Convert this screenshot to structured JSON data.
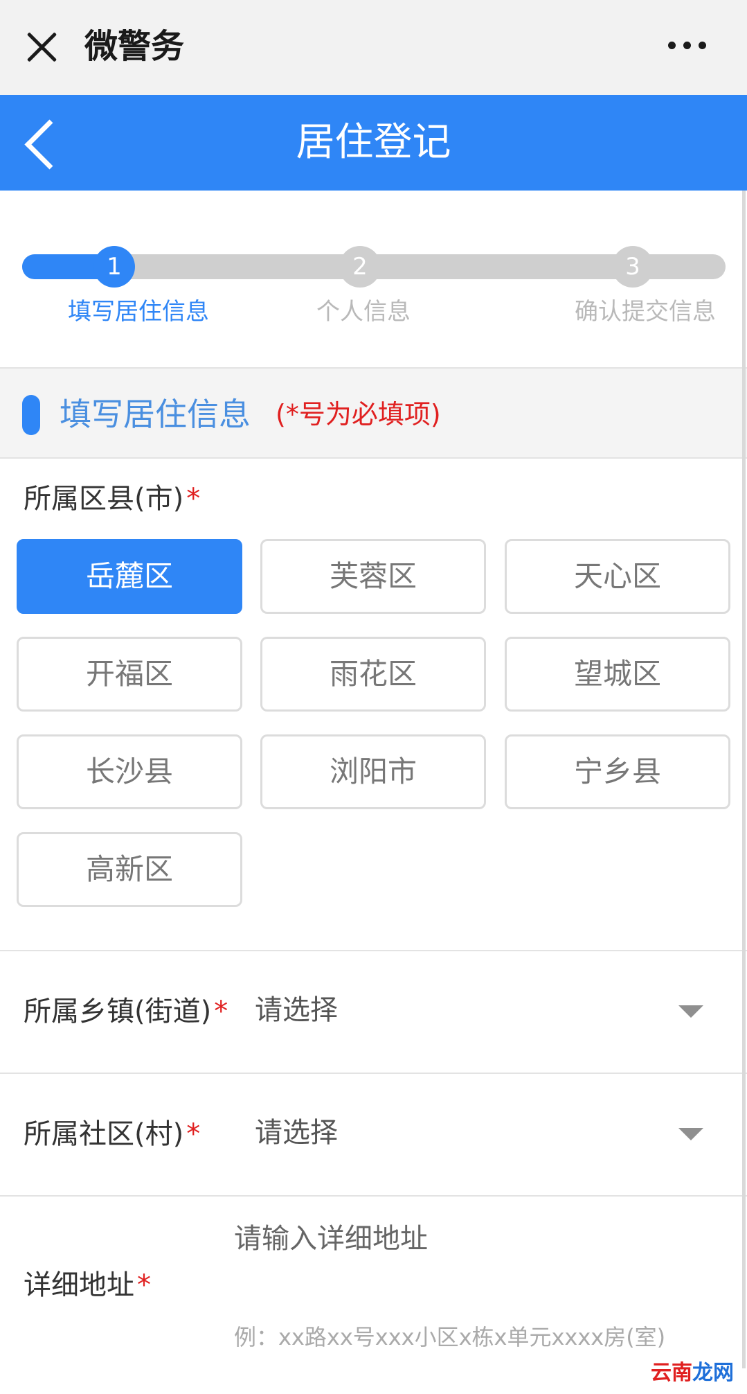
{
  "wechat": {
    "title": "微警务"
  },
  "header": {
    "title": "居住登记"
  },
  "steps": [
    {
      "num": "1",
      "label": "填写居住信息"
    },
    {
      "num": "2",
      "label": "个人信息"
    },
    {
      "num": "3",
      "label": "确认提交信息"
    }
  ],
  "section": {
    "title": "填写居住信息",
    "note": "(*号为必填项)"
  },
  "district": {
    "label": "所属区县(市)",
    "required_mark": "*",
    "options": [
      "岳麓区",
      "芙蓉区",
      "天心区",
      "开福区",
      "雨花区",
      "望城区",
      "长沙县",
      "浏阳市",
      "宁乡县",
      "高新区"
    ],
    "selected": "岳麓区"
  },
  "town": {
    "label": "所属乡镇(街道)",
    "required_mark": "*",
    "value": "请选择"
  },
  "community": {
    "label": "所属社区(村)",
    "required_mark": "*",
    "value": "请选择"
  },
  "address": {
    "label": "详细地址",
    "required_mark": "*",
    "placeholder": "请输入详细地址",
    "hint": "例：xx路xx号xxx小区x栋x单元xxxx房(室)"
  },
  "watermark": {
    "part1": "云",
    "part2": "南",
    "part3": "龙网"
  },
  "colors": {
    "primary": "#2f86f6",
    "required": "#e02020"
  }
}
